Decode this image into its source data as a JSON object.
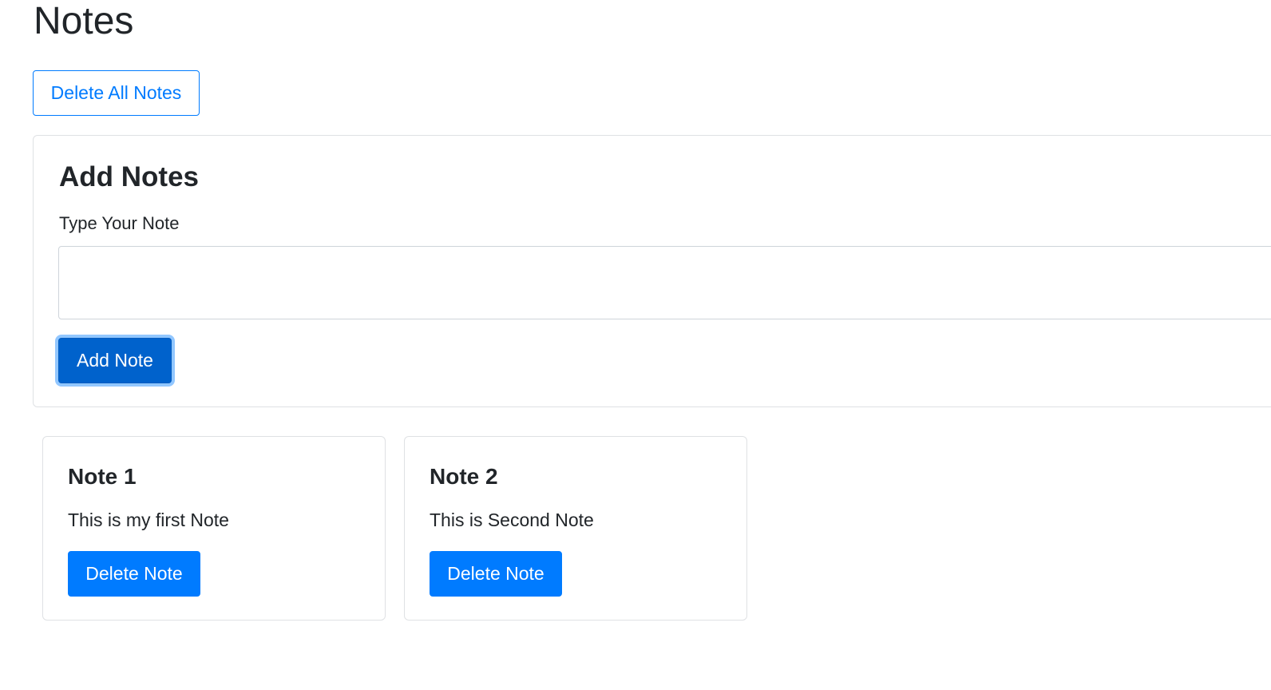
{
  "page": {
    "title": "Notes"
  },
  "toolbar": {
    "delete_all_label": "Delete All Notes"
  },
  "add_form": {
    "title": "Add Notes",
    "label": "Type Your Note",
    "textarea_value": "",
    "submit_label": "Add Note"
  },
  "notes": [
    {
      "title": "Note 1",
      "text": "This is my first Note",
      "delete_label": "Delete Note"
    },
    {
      "title": "Note 2",
      "text": "This is Second Note",
      "delete_label": "Delete Note"
    }
  ],
  "colors": {
    "primary": "#007bff",
    "primary_active": "#0062cc",
    "text": "#212529",
    "border": "#dfe1e4"
  }
}
